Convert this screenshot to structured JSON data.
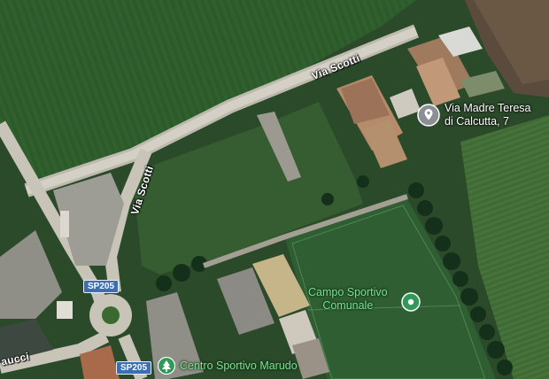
{
  "roads": {
    "via_scotti_upper": "Via Scotti",
    "via_scotti_left": "Via Scotti",
    "partial_street": "aucci"
  },
  "shields": {
    "sp205_upper": "SP205",
    "sp205_lower": "SP205"
  },
  "places": {
    "address": {
      "line1": "Via Madre Teresa",
      "line2": "di Calcutta, 7",
      "icon": "location-pin-icon"
    },
    "campo": {
      "line1": "Campo Sportivo",
      "line2": "Comunale",
      "icon": "green-poi-pin-icon"
    },
    "centro": {
      "name": "Centro Sportivo Marudo",
      "icon": "tree-icon"
    }
  },
  "colors": {
    "field_dark": "#234a23",
    "field_light": "#3f6a35",
    "road": "#c9c5b8",
    "poi_green": "#7ce28f",
    "shield_blue": "#3a6fb5"
  }
}
